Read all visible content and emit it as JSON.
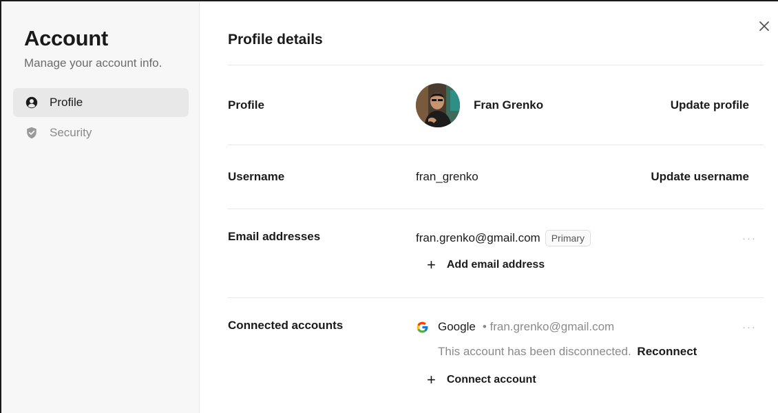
{
  "sidebar": {
    "title": "Account",
    "subtitle": "Manage your account info.",
    "items": [
      {
        "label": "Profile",
        "icon": "user-circle-icon",
        "active": true
      },
      {
        "label": "Security",
        "icon": "shield-check-icon",
        "active": false
      }
    ]
  },
  "main": {
    "title": "Profile details",
    "close_icon": "close-icon",
    "profile": {
      "label": "Profile",
      "name": "Fran Grenko",
      "action": "Update profile"
    },
    "username": {
      "label": "Username",
      "value": "fran_grenko",
      "action": "Update username"
    },
    "emails": {
      "label": "Email addresses",
      "primary_email": "fran.grenko@gmail.com",
      "badge": "Primary",
      "more": "···",
      "add_label": "Add email address"
    },
    "connected": {
      "label": "Connected accounts",
      "provider": "Google",
      "provider_email": "• fran.grenko@gmail.com",
      "status": "This account has been disconnected.",
      "reconnect": "Reconnect",
      "more": "···",
      "connect_label": "Connect account"
    }
  },
  "colors": {
    "sidebar_bg": "#f7f7f7",
    "active_item_bg": "#e8e8e8",
    "muted_text": "#8a8a8a",
    "divider": "#e9e9e9"
  }
}
